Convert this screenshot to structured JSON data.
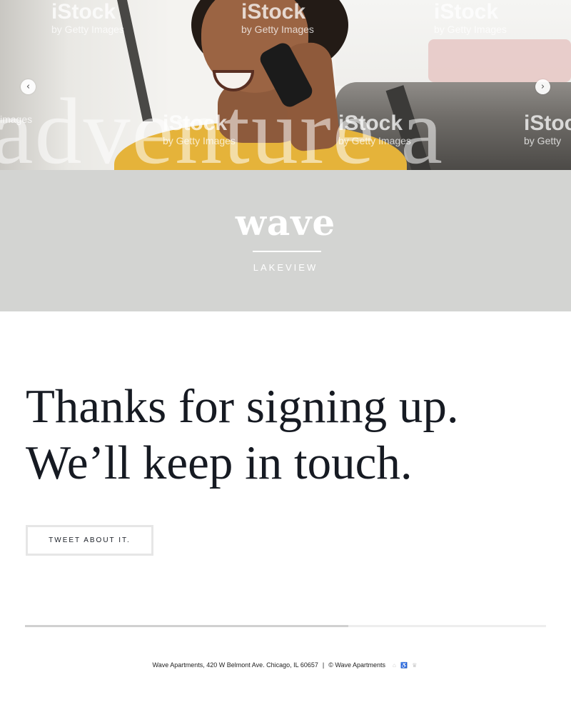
{
  "hero": {
    "overlay_word": "adventure a",
    "watermark_brand": "iStock",
    "watermark_sub": "by Getty Images",
    "watermark_sub_short": "images",
    "watermark_sub_getty": "by Getty",
    "prev_icon": "‹",
    "next_icon": "›"
  },
  "brand": {
    "logo": "wave",
    "location": "LAKEVIEW"
  },
  "main": {
    "headline_line1": "Thanks for signing up.",
    "headline_line2": "We’ll keep in touch.",
    "tweet_button": "TWEET ABOUT IT."
  },
  "progress": {
    "fraction": 0.62
  },
  "footer": {
    "address": "Wave Apartments, 420 W Belmont Ave. Chicago, IL 60657",
    "separator": "|",
    "copyright": "© Wave Apartments",
    "icons": "⌂ ♿ ♛"
  },
  "colors": {
    "band": "#d3d4d2",
    "text": "#161a22",
    "button_border": "#e6e6e6"
  }
}
